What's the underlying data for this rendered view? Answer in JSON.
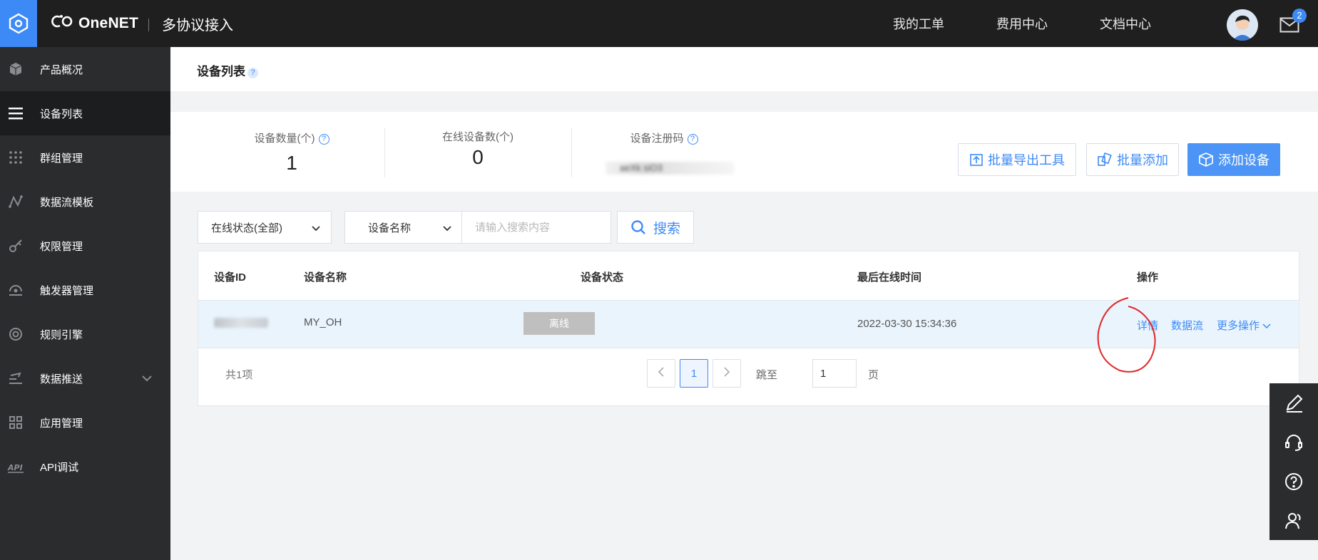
{
  "header": {
    "brand": "OneNET",
    "product": "多协议接入",
    "nav": [
      "我的工单",
      "费用中心",
      "文档中心"
    ],
    "mail_badge": "2",
    "accent": "#3d8af7"
  },
  "sidebar": {
    "items": [
      {
        "label": "产品概况",
        "icon": "cube-icon"
      },
      {
        "label": "设备列表",
        "icon": "list-icon"
      },
      {
        "label": "群组管理",
        "icon": "grid-dots-icon"
      },
      {
        "label": "数据流模板",
        "icon": "data-flow-icon"
      },
      {
        "label": "权限管理",
        "icon": "key-icon"
      },
      {
        "label": "触发器管理",
        "icon": "trigger-icon"
      },
      {
        "label": "规则引擎",
        "icon": "target-icon"
      },
      {
        "label": "数据推送",
        "icon": "push-icon"
      },
      {
        "label": "应用管理",
        "icon": "apps-icon"
      },
      {
        "label": "API调试",
        "icon": "api-icon"
      }
    ],
    "active_index": 1
  },
  "page": {
    "title": "设备列表",
    "help": "?"
  },
  "stats": {
    "device_count_label": "设备数量(个)",
    "device_count": "1",
    "online_count_label": "在线设备数(个)",
    "online_count": "0",
    "register_code_label": "设备注册码",
    "register_code_partial": "aeXk  siO3"
  },
  "actions": {
    "export_label": "批量导出工具",
    "batch_add_label": "批量添加",
    "add_device_label": "添加设备"
  },
  "filters": {
    "status_select": "在线状态(全部)",
    "field_select": "设备名称",
    "search_placeholder": "请输入搜索内容",
    "search_label": "搜索"
  },
  "table": {
    "columns": [
      "设备ID",
      "设备名称",
      "设备状态",
      "最后在线时间",
      "操作"
    ],
    "rows": [
      {
        "name": "MY_OH",
        "status": "离线",
        "last_online": "2022-03-30 15:34:36",
        "ops": [
          "详情",
          "数据流",
          "更多操作"
        ]
      }
    ]
  },
  "pagination": {
    "total": "共1项",
    "current_page": "1",
    "jump_label": "跳至",
    "jump_value": "1",
    "page_suffix": "页"
  },
  "floating_tools": [
    "edit-icon",
    "headset-icon",
    "help-circle-icon",
    "feedback-user-icon"
  ]
}
